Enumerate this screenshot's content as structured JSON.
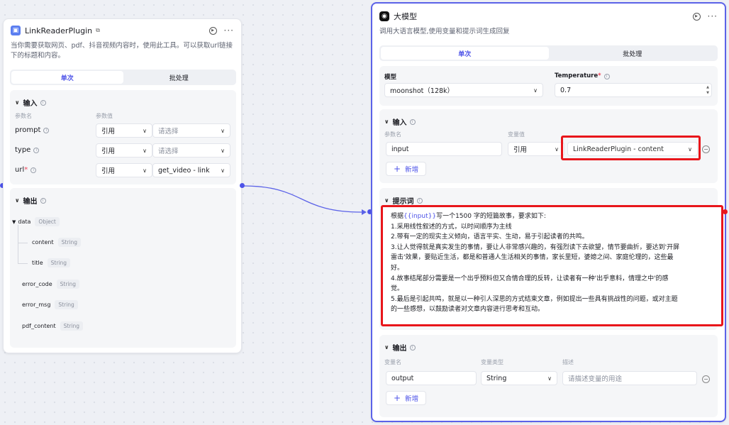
{
  "left_node": {
    "title": "LinkReaderPlugin",
    "description": "当你需要获取网页、pdf、抖音视频内容时，使用此工具。可以获取url链接下的标题和内容。",
    "tabs": [
      "单次",
      "批处理"
    ],
    "input_section": {
      "title": "输入",
      "col_name": "参数名",
      "col_value": "参数值",
      "params": [
        {
          "name": "prompt",
          "required": false,
          "mode": "引用",
          "value": "请选择",
          "is_placeholder": true
        },
        {
          "name": "type",
          "required": false,
          "mode": "引用",
          "value": "请选择",
          "is_placeholder": true
        },
        {
          "name": "url",
          "required": true,
          "mode": "引用",
          "value": "get_video - link",
          "is_placeholder": false
        }
      ]
    },
    "output_section": {
      "title": "输出",
      "fields": [
        {
          "name": "data",
          "type": "Object"
        },
        {
          "name": "content",
          "type": "String"
        },
        {
          "name": "title",
          "type": "String"
        },
        {
          "name": "error_code",
          "type": "String"
        },
        {
          "name": "error_msg",
          "type": "String"
        },
        {
          "name": "pdf_content",
          "type": "String"
        }
      ]
    }
  },
  "right_node": {
    "title": "大模型",
    "description": "调用大语言模型,使用变量和提示词生成回复",
    "tabs": [
      "单次",
      "批处理"
    ],
    "model_label": "模型",
    "model_value": "moonshot（128k）",
    "temperature_label": "Temperature",
    "temperature_value": "0.7",
    "input_section": {
      "title": "输入",
      "col_name": "参数名",
      "col_value": "变量值",
      "param_name": "input",
      "mode": "引用",
      "value": "LinkReaderPlugin - content",
      "add_label": "新增"
    },
    "prompt_section": {
      "title": "提示词",
      "prefix": "根据",
      "variable": "{{input}}",
      "first_line_rest": "写一个1500 字的短篇故事，要求如下:",
      "lines": [
        "1.采用线性叙述的方式，以时间顺序为主线",
        "2.带有一定的现实主义倾向，语言平实、生动，易于引起读者的共鸣。",
        "3.让人觉得就是真实发生的事情，要让人非常感兴趣的，有强烈读下去欲望，情节要曲折，要达到'开屏",
        "雷击'效果，要贴近生活，都是和普通人生活相关的事情，家长里短，婆媳之间、家庭伦理的，这些最",
        "好。",
        "4.故事结尾部分需要是一个出乎预料但又合情合理的反转，让读者有一种'出乎意料，情理之中'的感",
        "觉。",
        "5.最后是引起共鸣，就是以一种引人深思的方式结束文章，例如提出一些具有挑战性的问题，或对主题",
        "的一些感想，以鼓励读者对文章内容进行思考和互动。"
      ]
    },
    "output_section": {
      "title": "输出",
      "col_name": "变量名",
      "col_type": "变量类型",
      "col_desc": "描述",
      "var_name": "output",
      "var_type": "String",
      "desc_placeholder": "请描述变量的用途",
      "add_label": "新增"
    }
  }
}
